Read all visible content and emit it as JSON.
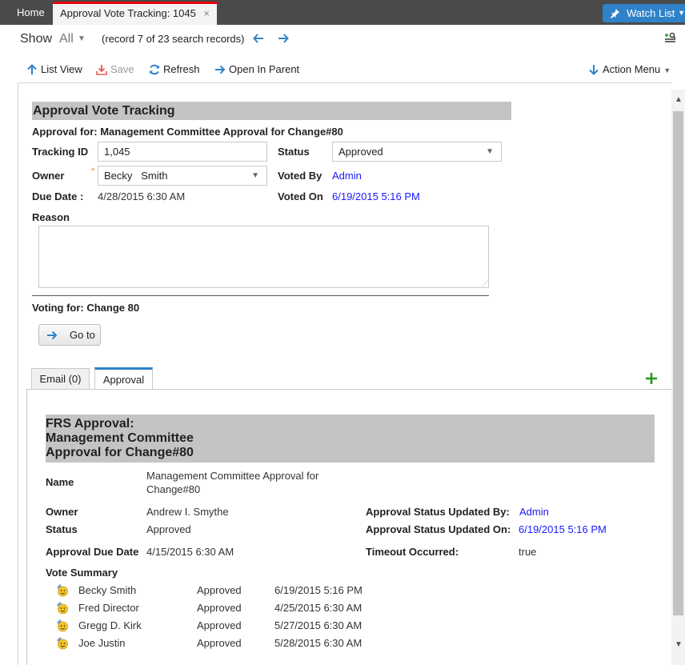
{
  "tabs": {
    "home": "Home",
    "active": "Approval Vote Tracking: 1045",
    "close": "×"
  },
  "watch_list": "Watch List",
  "nav": {
    "show_label": "Show",
    "show_value": "All",
    "record_count": "(record 7 of 23 search records)"
  },
  "toolbar": {
    "list_view": "List View",
    "save": "Save",
    "refresh": "Refresh",
    "open_in_parent": "Open In Parent",
    "action_menu": "Action Menu"
  },
  "form": {
    "title": "Approval Vote Tracking",
    "approval_for": "Approval for: Management Committee Approval for Change#80",
    "tracking_id_label": "Tracking ID",
    "tracking_id_value": "1,045",
    "status_label": "Status",
    "status_value": "Approved",
    "owner_label": "Owner",
    "owner_value": "Becky   Smith",
    "required_mark": "*",
    "voted_by_label": "Voted By",
    "voted_by_value": "Admin",
    "due_date_label": "Due Date :",
    "due_date_value": "4/28/2015 6:30 AM",
    "voted_on_label": "Voted On",
    "voted_on_value": "6/19/2015 5:16 PM",
    "reason_label": "Reason",
    "reason_value": "",
    "voting_for": "Voting for: Change 80",
    "goto_label": "Go to"
  },
  "subtabs": [
    {
      "label": "Email (0)"
    },
    {
      "label": "Approval"
    }
  ],
  "approval": {
    "title_line1": "FRS Approval:",
    "title_line2": "Management Committee",
    "title_line3": "Approval for Change#80",
    "name_label": "Name",
    "name_value_line1": "Management Committee Approval for",
    "name_value_line2": "Change#80",
    "owner_label": "Owner",
    "owner_value": "Andrew I. Smythe",
    "status_label": "Status",
    "status_value": "Approved",
    "updated_by_label": "Approval Status Updated By:",
    "updated_by_value": "Admin",
    "updated_on_label": "Approval Status Updated On:",
    "updated_on_value": "6/19/2015 5:16 PM",
    "due_date_label": "Approval Due Date",
    "due_date_value": "4/15/2015 6:30 AM",
    "timeout_label": "Timeout Occurred:",
    "timeout_value": "true",
    "vote_summary_label": "Vote Summary",
    "votes": [
      {
        "name": "Becky Smith",
        "status": "Approved",
        "date": "6/19/2015 5:16 PM"
      },
      {
        "name": "Fred Director",
        "status": "Approved",
        "date": "4/25/2015 6:30 AM"
      },
      {
        "name": "Gregg D. Kirk",
        "status": "Approved",
        "date": "5/27/2015 6:30 AM"
      },
      {
        "name": "Joe Justin",
        "status": "Approved",
        "date": "5/28/2015 6:30 AM"
      }
    ]
  },
  "colors": {
    "accent": "#2f82c8",
    "link": "#1a1aff",
    "active_tab_indicator": "#e8000d",
    "section_header": "#c4c4c4",
    "add_green": "#1f9a1f"
  },
  "icons": {
    "pin": "pin-icon",
    "prev": "arrow-left-icon",
    "next": "arrow-right-icon",
    "list_view": "arrow-up-icon",
    "save": "save-download-icon",
    "refresh": "refresh-icon",
    "open_parent": "arrow-right-icon",
    "action_menu": "arrow-down-icon",
    "add": "plus-icon",
    "voter": "user-smiley-icon"
  }
}
